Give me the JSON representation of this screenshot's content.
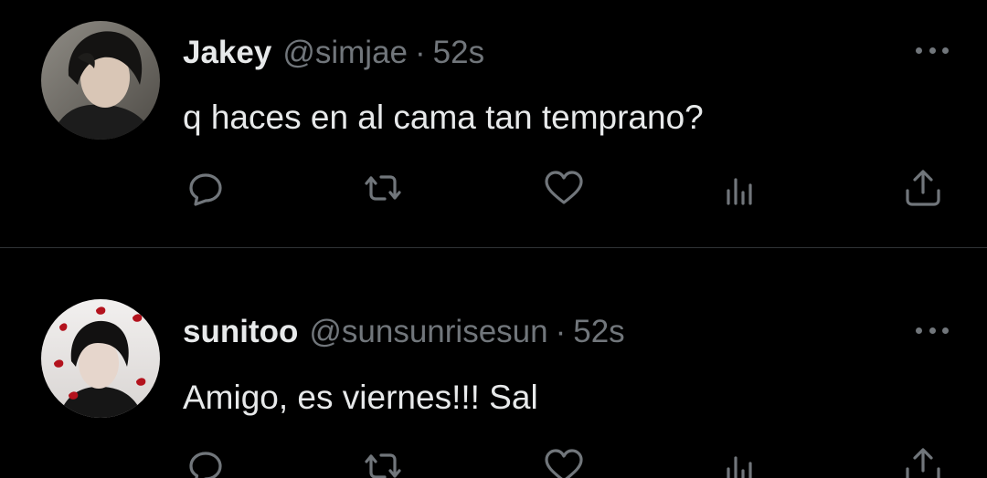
{
  "tweets": [
    {
      "name": "Jakey",
      "handle": "@simjae",
      "separator": "·",
      "time": "52s",
      "text": "q haces en al cama tan temprano?",
      "avatar": "profile-photo"
    },
    {
      "name": "sunitoo",
      "handle": "@sunsunrisesun",
      "separator": "·",
      "time": "52s",
      "text": "Amigo, es viernes!!! Sal",
      "avatar": "profile-photo"
    }
  ],
  "icons": {
    "reply": "reply-icon",
    "retweet": "retweet-icon",
    "like": "heart-icon",
    "views": "views-icon",
    "share": "share-icon",
    "more": "more-icon"
  },
  "colors": {
    "background": "#000000",
    "text": "#e7e9ea",
    "secondary": "#71767b",
    "divider": "#2f3336"
  }
}
